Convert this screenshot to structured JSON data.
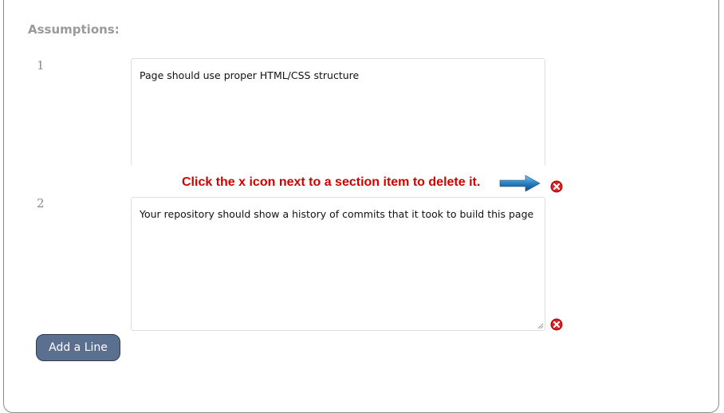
{
  "section": {
    "title": "Assumptions:"
  },
  "lines": [
    {
      "number": "1",
      "text": "Page should use proper HTML/CSS structure"
    },
    {
      "number": "2",
      "text": "Your repository should show a history of commits that it took to build this page"
    }
  ],
  "hint": {
    "text": "Click the x icon next to a section item to delete it."
  },
  "actions": {
    "add_line_label": "Add a Line"
  },
  "colors": {
    "hint_text": "#d40000",
    "delete_icon": "#b01010",
    "button_bg": "#5b6f8f",
    "arrow": "#2a7fc0"
  }
}
